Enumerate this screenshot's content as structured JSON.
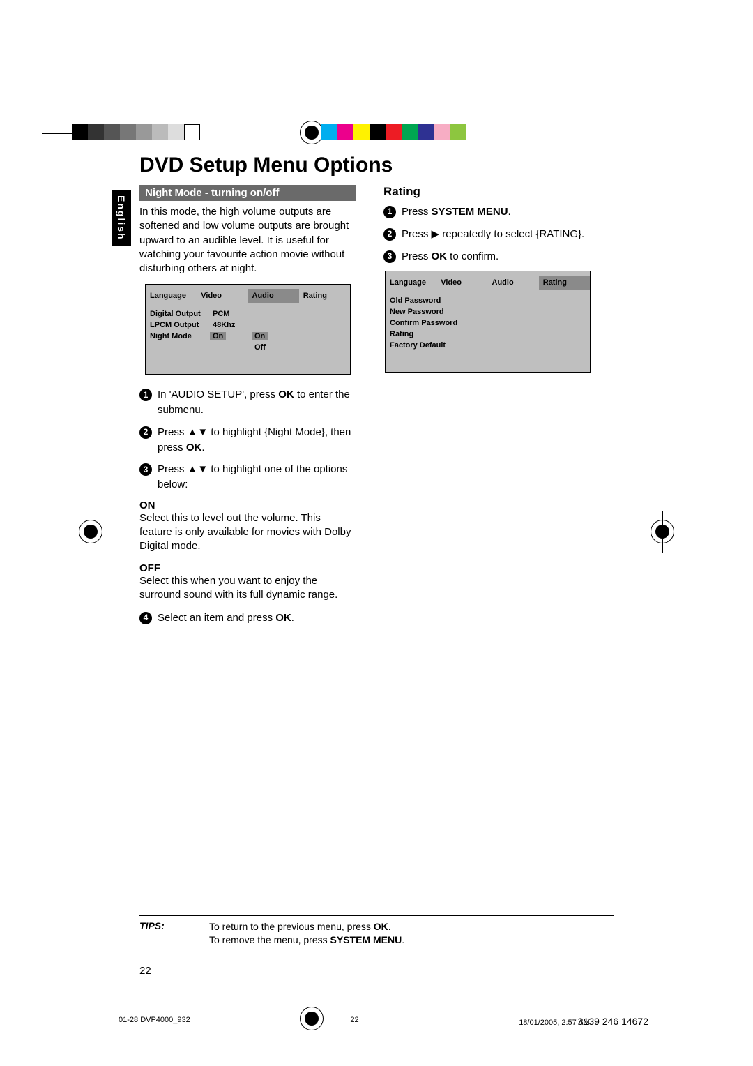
{
  "language_tab": "English",
  "page_title": "DVD Setup Menu Options",
  "left": {
    "section_bar": "Night Mode - turning on/off",
    "intro": "In this mode, the high volume outputs are softened and low volume outputs are brought upward to an audible level. It is useful for watching your favourite action movie without disturbing others at night.",
    "menu": {
      "tabs": [
        "Language",
        "Video",
        "Audio",
        "Rating"
      ],
      "highlighted_tab": "Audio",
      "rows": [
        {
          "label": "Digital Output",
          "value": "PCM"
        },
        {
          "label": "LPCM Output",
          "value": "48Khz"
        },
        {
          "label": "Night Mode",
          "value": "On",
          "options": [
            "On",
            "Off"
          ],
          "highlighted": true
        }
      ]
    },
    "steps": [
      {
        "num": "1",
        "text_before": "In 'AUDIO SETUP', press ",
        "bold": "OK",
        "text_after": " to enter the submenu."
      },
      {
        "num": "2",
        "text_before": "Press ▲▼ to highlight {Night Mode}, then press ",
        "bold": "OK",
        "text_after": "."
      },
      {
        "num": "3",
        "text_before": "Press ▲▼ to highlight one of the options below:",
        "bold": "",
        "text_after": ""
      }
    ],
    "options": [
      {
        "label": "ON",
        "text": "Select this to level out the volume. This feature is only available for movies with Dolby Digital mode."
      },
      {
        "label": "OFF",
        "text": "Select this when you want to enjoy the surround sound with its full dynamic range."
      }
    ],
    "step4": {
      "num": "4",
      "text_before": "Select an item and press ",
      "bold": "OK",
      "text_after": "."
    }
  },
  "right": {
    "heading": "Rating",
    "steps": [
      {
        "num": "1",
        "text_before": "Press ",
        "bold": "SYSTEM MENU",
        "text_after": "."
      },
      {
        "num": "2",
        "text_before": "Press ▶ repeatedly to select {RATING}.",
        "bold": "",
        "text_after": ""
      },
      {
        "num": "3",
        "text_before": "Press ",
        "bold": "OK",
        "text_after": " to confirm."
      }
    ],
    "menu": {
      "tabs": [
        "Language",
        "Video",
        "Audio",
        "Rating"
      ],
      "highlighted_tab": "Rating",
      "items": [
        "Old Password",
        "New Password",
        "Confirm Password",
        "Rating",
        "Factory Default"
      ]
    }
  },
  "tips": {
    "label": "TIPS:",
    "line1_a": "To return to the previous menu, press ",
    "line1_b": "OK",
    "line1_c": ".",
    "line2_a": "To remove the menu, press ",
    "line2_b": "SYSTEM MENU",
    "line2_c": "."
  },
  "page_number": "22",
  "footer": {
    "file": "01-28 DVP4000_932",
    "page": "22",
    "date": "18/01/2005, 2:57 AM",
    "code": "3139 246 14672"
  },
  "colorbars_left": [
    "#000",
    "#333",
    "#555",
    "#777",
    "#999",
    "#bbb",
    "#ddd",
    "#fff"
  ],
  "colorbars_right": [
    "#00AEEF",
    "#EC008C",
    "#FFF200",
    "#000",
    "#ED1C24",
    "#00A651",
    "#2E3192",
    "#F7ADC4",
    "#8DC63F"
  ]
}
